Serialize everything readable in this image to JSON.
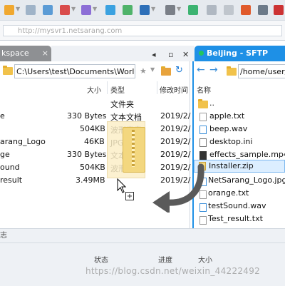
{
  "address_bar": {
    "text": "http://mysvr1.netsarang.com"
  },
  "tabs": {
    "left_label": "kspace",
    "right_label": "Beijing - SFTP",
    "right_status_color": "#22c55e",
    "active_color": "#1e90e6"
  },
  "left_pane": {
    "path": "C:\\Users\\test\\Documents\\Worl",
    "columns": {
      "size": "大小",
      "type": "类型",
      "modified": "修改时间"
    },
    "rows": [
      {
        "name": "",
        "size": "",
        "type": "文件夹",
        "modified": ""
      },
      {
        "name": "e",
        "size": "330 Bytes",
        "type": "文本文档",
        "modified": "2019/2/"
      },
      {
        "name": "",
        "size": "504KB",
        "type": "波形声音",
        "modified": "2019/2/"
      },
      {
        "name": "arang_Logo",
        "size": "46KB",
        "type": "JPG 文件",
        "modified": "2019/2/"
      },
      {
        "name": "ge",
        "size": "330 Bytes",
        "type": "文本文档",
        "modified": "2019/2/"
      },
      {
        "name": "ound",
        "size": "504KB",
        "type": "波形声音",
        "modified": "2019/2/"
      },
      {
        "name": "result",
        "size": "3.49MB",
        "type": "",
        "modified": "2019/2/"
      }
    ]
  },
  "right_pane": {
    "path": "/home/user/",
    "column_name": "名称",
    "files": [
      {
        "name": "..",
        "icon": "folder-icon"
      },
      {
        "name": "apple.txt",
        "icon": "text-file-icon"
      },
      {
        "name": "beep.wav",
        "icon": "audio-file-icon"
      },
      {
        "name": "desktop.ini",
        "icon": "settings-file-icon"
      },
      {
        "name": "effects_sample.mp4",
        "icon": "video-file-icon"
      },
      {
        "name": "Installer.zip",
        "icon": "zip-file-icon"
      },
      {
        "name": "NetSarang_Logo.jpg",
        "icon": "image-file-icon"
      },
      {
        "name": "orange.txt",
        "icon": "text-file-icon"
      },
      {
        "name": "testSound.wav",
        "icon": "audio-file-icon"
      },
      {
        "name": "Test_result.txt",
        "icon": "text-file-icon"
      }
    ]
  },
  "status_panel": {
    "tab_label": "志",
    "columns": {
      "status": "状态",
      "progress": "进度",
      "size": "大小"
    }
  },
  "watermark": "https://blog.csdn.net/weixin_44222492"
}
